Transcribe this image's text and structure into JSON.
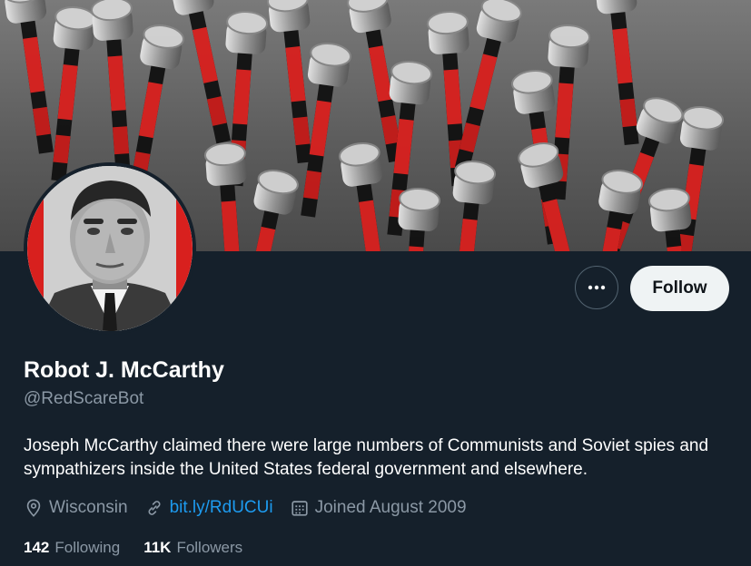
{
  "profile": {
    "name": "Robot J. McCarthy",
    "handle": "@RedScareBot",
    "bio": "Joseph McCarthy claimed there were large numbers of Communists and Soviet spies and sympathizers inside the United States federal government and elsewhere.",
    "location": "Wisconsin",
    "link": "bit.ly/RdUCUi",
    "joined": "Joined August 2009"
  },
  "actions": {
    "follow_label": "Follow",
    "more_icon": "more-horizontal-icon"
  },
  "stats": {
    "following_count": "142",
    "following_label": "Following",
    "followers_count": "11K",
    "followers_label": "Followers"
  },
  "icons": {
    "location": "location-pin-icon",
    "link": "link-icon",
    "calendar": "calendar-icon"
  },
  "colors": {
    "background": "#15202b",
    "accent_link": "#1d9bf0",
    "secondary_text": "#8b98a5",
    "follow_button_bg": "#eff3f4",
    "banner_red": "#d8201e"
  }
}
